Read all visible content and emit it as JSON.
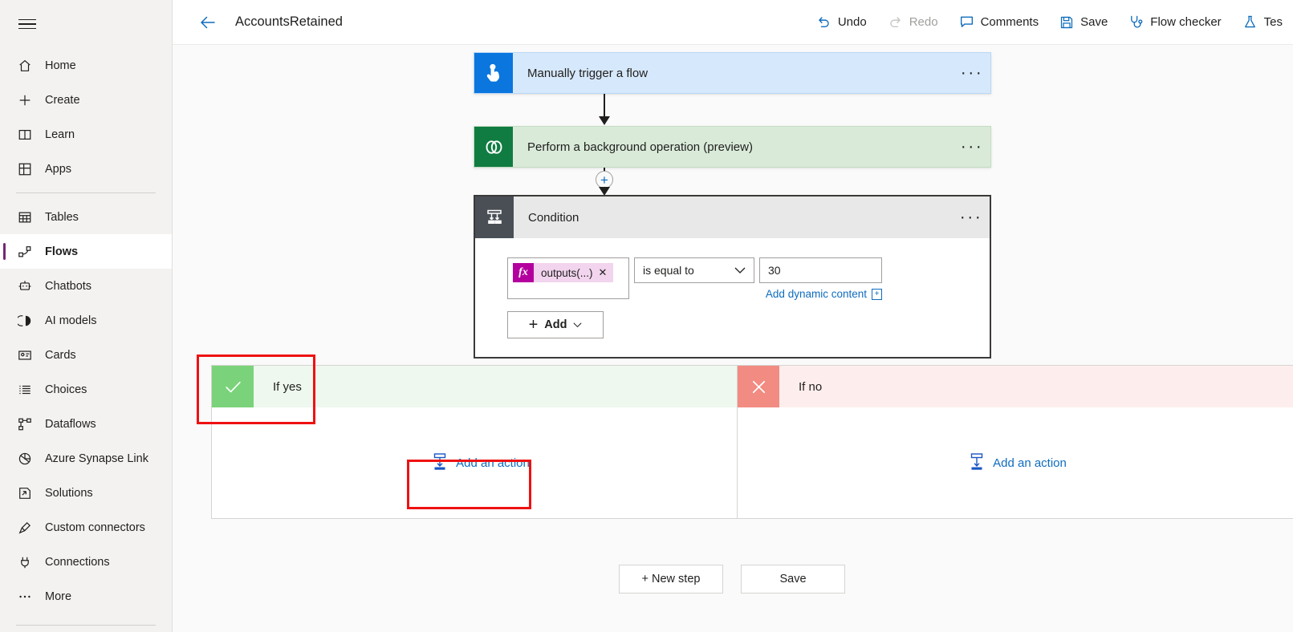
{
  "sidebar": {
    "menu_icon": "hamburger-icon",
    "items": [
      {
        "label": "Home",
        "icon": "home-icon",
        "active": false
      },
      {
        "label": "Create",
        "icon": "plus-icon",
        "active": false
      },
      {
        "label": "Learn",
        "icon": "book-icon",
        "active": false
      },
      {
        "label": "Apps",
        "icon": "apps-grid-icon",
        "active": false
      },
      {
        "label": "Tables",
        "icon": "table-icon",
        "active": false,
        "separator_before": true
      },
      {
        "label": "Flows",
        "icon": "flow-icon",
        "active": true
      },
      {
        "label": "Chatbots",
        "icon": "chatbot-icon",
        "active": false
      },
      {
        "label": "AI models",
        "icon": "ai-model-icon",
        "active": false
      },
      {
        "label": "Cards",
        "icon": "card-icon",
        "active": false
      },
      {
        "label": "Choices",
        "icon": "list-icon",
        "active": false
      },
      {
        "label": "Dataflows",
        "icon": "dataflow-icon",
        "active": false
      },
      {
        "label": "Azure Synapse Link",
        "icon": "synapse-icon",
        "active": false
      },
      {
        "label": "Solutions",
        "icon": "solutions-icon",
        "active": false
      },
      {
        "label": "Custom connectors",
        "icon": "connector-icon",
        "active": false
      },
      {
        "label": "Connections",
        "icon": "plug-icon",
        "active": false
      },
      {
        "label": "More",
        "icon": "ellipsis-icon",
        "active": false
      }
    ]
  },
  "topbar": {
    "back_icon": "back-arrow-icon",
    "flow_name": "AccountsRetained",
    "commands": [
      {
        "label": "Undo",
        "icon": "undo-icon",
        "disabled": false
      },
      {
        "label": "Redo",
        "icon": "redo-icon",
        "disabled": true
      },
      {
        "label": "Comments",
        "icon": "comment-icon",
        "disabled": false
      },
      {
        "label": "Save",
        "icon": "save-icon",
        "disabled": false
      },
      {
        "label": "Flow checker",
        "icon": "stethoscope-icon",
        "disabled": false
      },
      {
        "label": "Tes",
        "icon": "flask-icon",
        "disabled": false
      }
    ]
  },
  "flow": {
    "trigger": {
      "title": "Manually trigger a flow",
      "icon": "manual-trigger-icon",
      "icon_color": "#0a76de",
      "card_color": "#d6e8fb",
      "overflow": "···"
    },
    "action": {
      "title": "Perform a background operation (preview)",
      "icon": "dataverse-icon",
      "icon_color": "#107c41",
      "card_color": "#d9ead9",
      "overflow": "···"
    },
    "insert_step": {
      "label": "+",
      "icon": "plus-circle-icon"
    },
    "condition": {
      "title": "Condition",
      "icon": "condition-branch-icon",
      "icon_color": "#4a4f56",
      "overflow": "···",
      "left_operand": {
        "fx_label": "fx",
        "token_text": "outputs(...)",
        "remove_label": "✕"
      },
      "operator": {
        "value": "is equal to",
        "chevron": "⌄"
      },
      "right_operand": {
        "value": "30"
      },
      "dynamic_content_link": {
        "label": "Add dynamic content",
        "badge": "+"
      },
      "add_button": {
        "label": "Add",
        "plus": "+",
        "chevron": "⌄"
      }
    },
    "branch_yes": {
      "label": "If yes",
      "icon": "checkmark-icon",
      "icon_bg": "#7ad37a",
      "header_bg": "#eef8ee",
      "add_action_label": "Add an action",
      "add_action_icon": "add-action-icon"
    },
    "branch_no": {
      "label": "If no",
      "icon": "cross-icon",
      "icon_bg": "#f28b82",
      "header_bg": "#fdeeed",
      "add_action_label": "Add an action",
      "add_action_icon": "add-action-icon"
    },
    "footer_buttons": [
      {
        "label": "+ New step"
      },
      {
        "label": "Save"
      }
    ]
  },
  "annotations": {
    "highlight_color": "#ef1111",
    "boxes": [
      {
        "name": "if-yes-header-highlight"
      },
      {
        "name": "add-an-action-highlight"
      }
    ]
  }
}
